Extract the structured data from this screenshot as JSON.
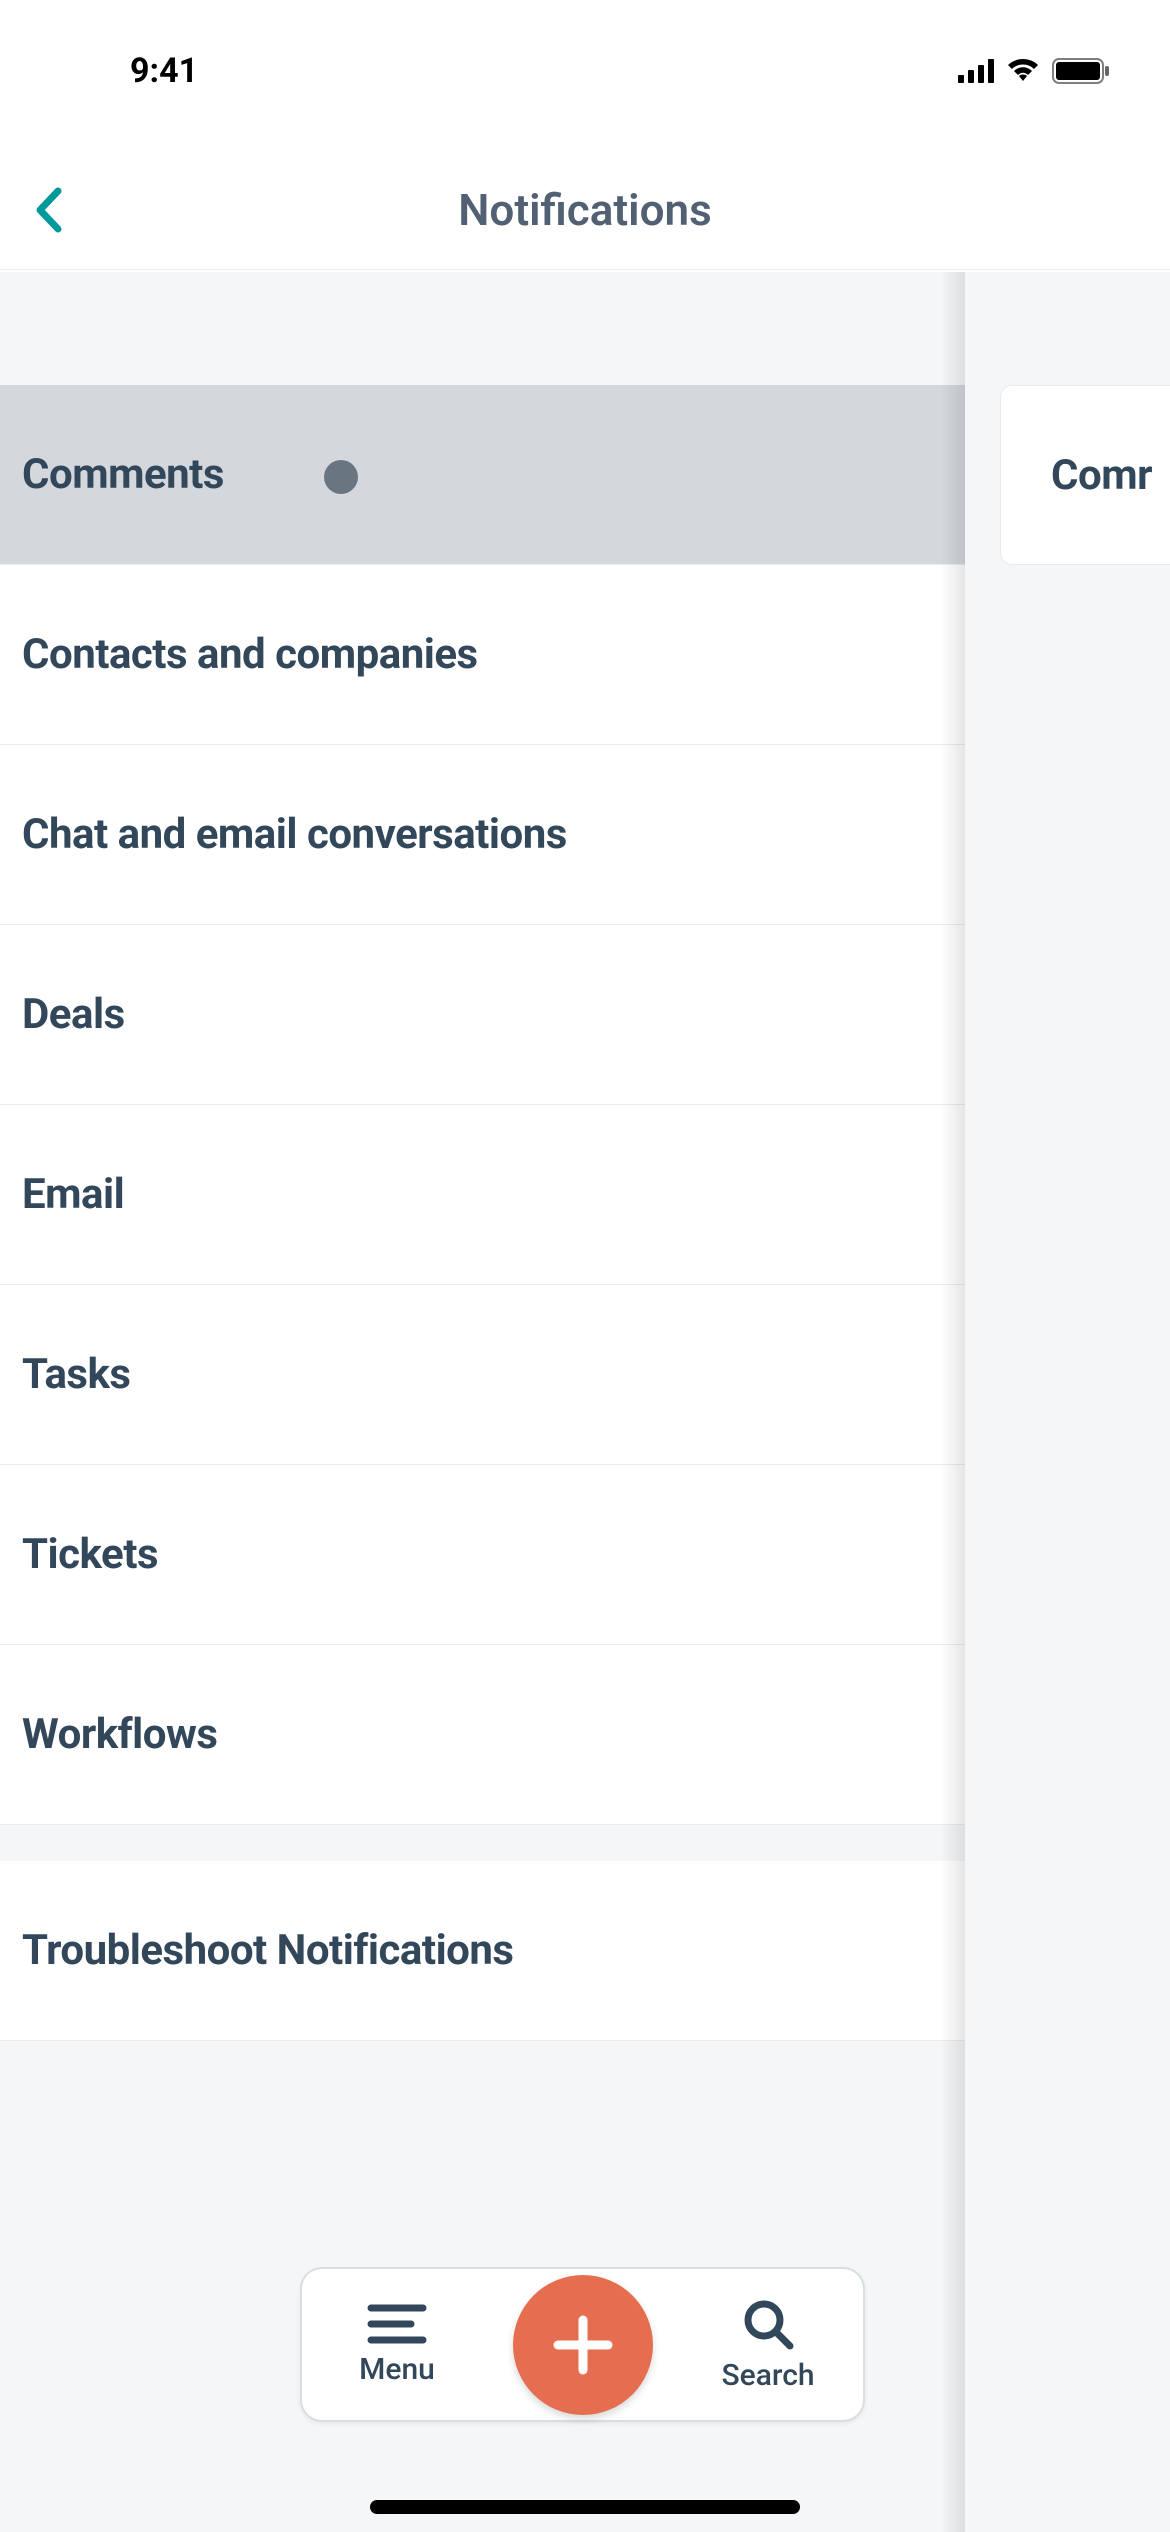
{
  "status": {
    "time": "9:41"
  },
  "header": {
    "title": "Notifications"
  },
  "list": {
    "group1": [
      {
        "label": "Comments",
        "selected": true,
        "has_dot": true
      },
      {
        "label": "Contacts and companies",
        "selected": false,
        "has_dot": false
      },
      {
        "label": "Chat and email conversations",
        "selected": false,
        "has_dot": false
      },
      {
        "label": "Deals",
        "selected": false,
        "has_dot": false
      },
      {
        "label": "Email",
        "selected": false,
        "has_dot": false
      },
      {
        "label": "Tasks",
        "selected": false,
        "has_dot": false
      },
      {
        "label": "Tickets",
        "selected": false,
        "has_dot": false
      },
      {
        "label": "Workflows",
        "selected": false,
        "has_dot": false
      }
    ],
    "group2": [
      {
        "label": "Troubleshoot Notifications",
        "selected": false,
        "has_dot": false
      }
    ]
  },
  "peek": {
    "label": "Comr"
  },
  "bottom": {
    "menu_label": "Menu",
    "search_label": "Search"
  },
  "colors": {
    "accent_teal": "#009999",
    "fab_orange": "#e66e50",
    "text": "#33475b",
    "header_text": "#516073",
    "selected_bg": "#d4d8dd",
    "body_bg": "#f4f6f8"
  },
  "icons": {
    "back": "chevron-left-icon",
    "menu": "menu-icon",
    "search": "search-icon",
    "add": "plus-icon",
    "signal": "cellular-signal-icon",
    "wifi": "wifi-icon",
    "battery": "battery-icon"
  }
}
